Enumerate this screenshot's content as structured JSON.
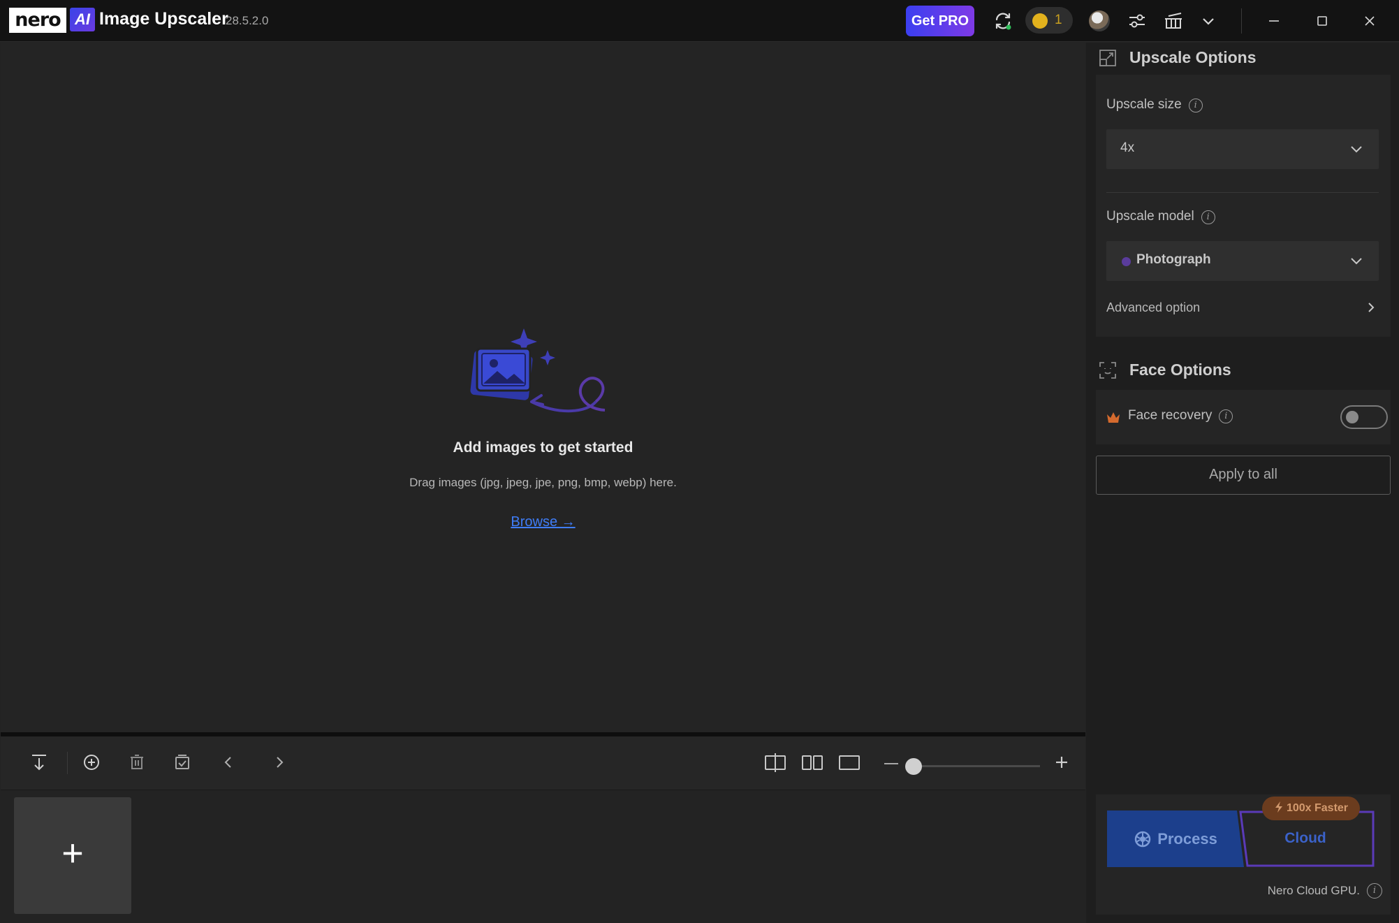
{
  "app": {
    "brand": "nero",
    "ai_badge": "AI",
    "title": "Image Upscaler",
    "version": "28.5.2.0"
  },
  "header": {
    "get_pro_label": "Get PRO",
    "credits": "1",
    "icons": [
      "sync-icon",
      "coin-icon",
      "avatar",
      "settings-sliders-icon",
      "gift-icon",
      "chevron-down-icon",
      "minimize-icon",
      "maximize-icon",
      "close-icon"
    ]
  },
  "canvas": {
    "empty_title": "Add images to get started",
    "empty_hint": "Drag images (jpg, jpeg, jpe, png, bmp, webp) here.",
    "browse_label": "Browse →"
  },
  "toolbar": {
    "icons": [
      "export-icon",
      "add-circle-icon",
      "trash-icon",
      "select-all-icon",
      "prev-icon",
      "next-icon",
      "split-view-icon",
      "side-by-side-icon",
      "single-view-icon",
      "zoom-out-icon",
      "zoom-in-icon"
    ],
    "zoom_level": 0.0
  },
  "tray": {
    "add_label": "+"
  },
  "panel": {
    "upscale_options": {
      "title": "Upscale Options",
      "size_label": "Upscale size",
      "size_value": "4x",
      "model_label": "Upscale model",
      "model_value": "Photograph",
      "advanced_label": "Advanced option"
    },
    "face_options": {
      "title": "Face Options",
      "face_recovery_label": "Face recovery",
      "face_recovery_on": false
    },
    "apply_all_label": "Apply to all",
    "process_label": "Process",
    "cloud_label": "Cloud",
    "faster_badge": "100x Faster",
    "cloud_note": "Nero Cloud GPU."
  },
  "colors": {
    "accent_blue": "#3f7df7",
    "pro_gradient_start": "#3b3ff0",
    "pro_gradient_end": "#7e3ae6",
    "process_bg": "#1c3f8c",
    "coin": "#e3b21d"
  }
}
